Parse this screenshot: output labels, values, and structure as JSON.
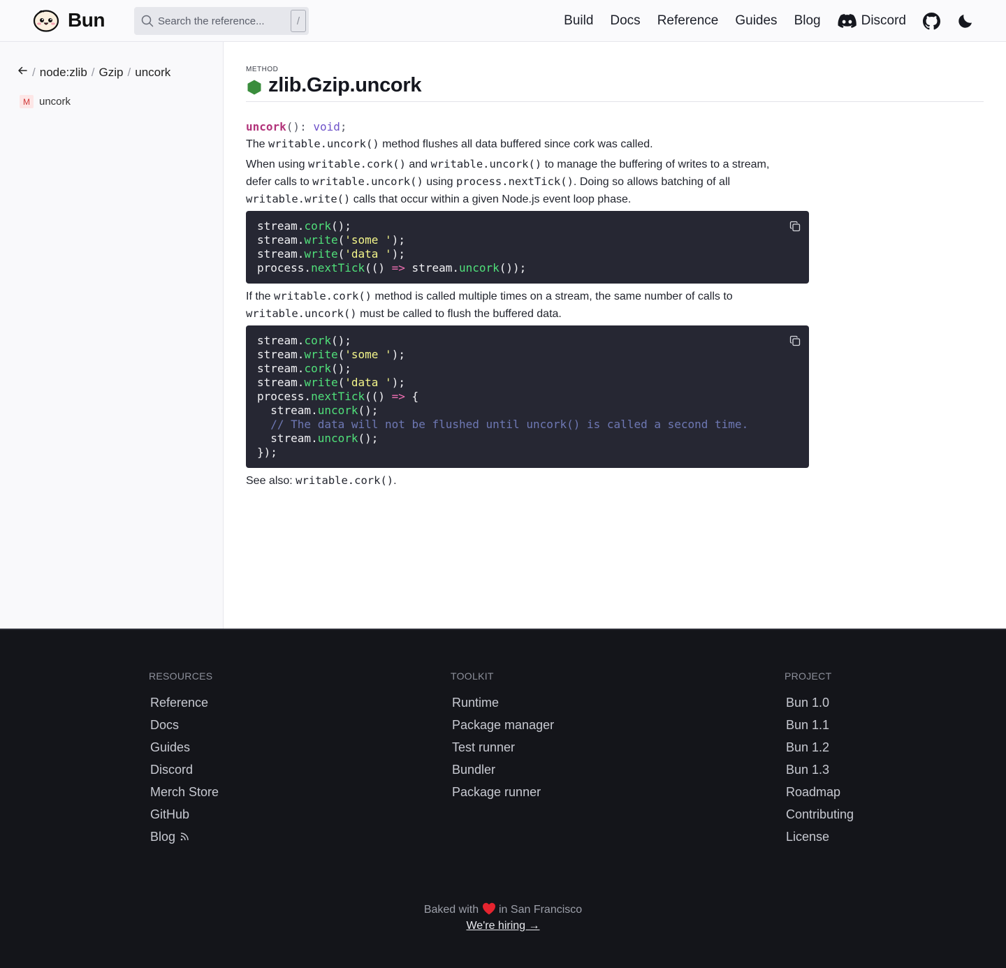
{
  "header": {
    "logo_text": "Bun",
    "search_placeholder": "Search the reference...",
    "search_shortcut": "/",
    "nav": [
      "Build",
      "Docs",
      "Reference",
      "Guides",
      "Blog"
    ],
    "discord_label": "Discord"
  },
  "sidebar": {
    "breadcrumb": [
      "node:zlib",
      "Gzip",
      "uncork"
    ],
    "items": [
      {
        "badge": "M",
        "label": "uncork"
      }
    ]
  },
  "main": {
    "kind": "METHOD",
    "title": "zlib.Gzip.uncork",
    "signature": {
      "name": "uncork",
      "parens": "(): ",
      "type": "void",
      "end": ";"
    },
    "p1": {
      "t1": "The ",
      "c1": "writable.uncork()",
      "t2": " method flushes all data buffered since cork was called."
    },
    "p2": {
      "t1": "When using ",
      "c1": "writable.cork()",
      "t2": " and ",
      "c2": "writable.uncork()",
      "t3": " to manage the buffering of writes to a stream,",
      "t4": "defer calls to ",
      "c3": "writable.uncork()",
      "t5": " using ",
      "c4": "process.nextTick()",
      "t6": ". Doing so allows batching of all",
      "c5": "writable.write()",
      "t7": " calls that occur within a given Node.js event loop phase."
    },
    "p3": {
      "t1": "If the ",
      "c1": "writable.cork()",
      "t2": " method is called multiple times on a stream, the same number of calls to",
      "c2": "writable.uncork()",
      "t3": " must be called to flush the buffered data."
    },
    "p4": {
      "t1": "See also: ",
      "c1": "writable.cork()",
      "t2": "."
    },
    "code1": {
      "l1": {
        "a": "stream.",
        "b": "cork",
        "c": "();"
      },
      "l2": {
        "a": "stream.",
        "b": "write",
        "c": "(",
        "d": "'some '",
        "e": ");"
      },
      "l3": {
        "a": "stream.",
        "b": "write",
        "c": "(",
        "d": "'data '",
        "e": ");"
      },
      "l4": {
        "a": "process.",
        "b": "nextTick",
        "c": "(() ",
        "d": "=>",
        "e": " stream.",
        "f": "uncork",
        "g": "());"
      }
    },
    "code2": {
      "l1": {
        "a": "stream.",
        "b": "cork",
        "c": "();"
      },
      "l2": {
        "a": "stream.",
        "b": "write",
        "c": "(",
        "d": "'some '",
        "e": ");"
      },
      "l3": {
        "a": "stream.",
        "b": "cork",
        "c": "();"
      },
      "l4": {
        "a": "stream.",
        "b": "write",
        "c": "(",
        "d": "'data '",
        "e": ");"
      },
      "l5": {
        "a": "process.",
        "b": "nextTick",
        "c": "(() ",
        "d": "=>",
        "e": " {"
      },
      "l6": {
        "a": "  stream.",
        "b": "uncork",
        "c": "();"
      },
      "l7": {
        "a": "  // The data will not be flushed until uncork() is called a second time."
      },
      "l8": {
        "a": "  stream.",
        "b": "uncork",
        "c": "();"
      },
      "l9": {
        "a": "});"
      }
    }
  },
  "footer": {
    "resources": {
      "title": "RESOURCES",
      "links": [
        "Reference",
        "Docs",
        "Guides",
        "Discord",
        "Merch Store",
        "GitHub",
        "Blog"
      ]
    },
    "toolkit": {
      "title": "TOOLKIT",
      "links": [
        "Runtime",
        "Package manager",
        "Test runner",
        "Bundler",
        "Package runner"
      ]
    },
    "project": {
      "title": "PROJECT",
      "links": [
        "Bun 1.0",
        "Bun 1.1",
        "Bun 1.2",
        "Bun 1.3",
        "Roadmap",
        "Contributing",
        "License"
      ]
    },
    "baked_pre": "Baked with",
    "baked_post": "in San Francisco",
    "hiring": "We're hiring →"
  },
  "colors": {
    "accent_method": "#3a8d3c",
    "code_bg": "#262733",
    "footer_bg": "#14151a"
  }
}
